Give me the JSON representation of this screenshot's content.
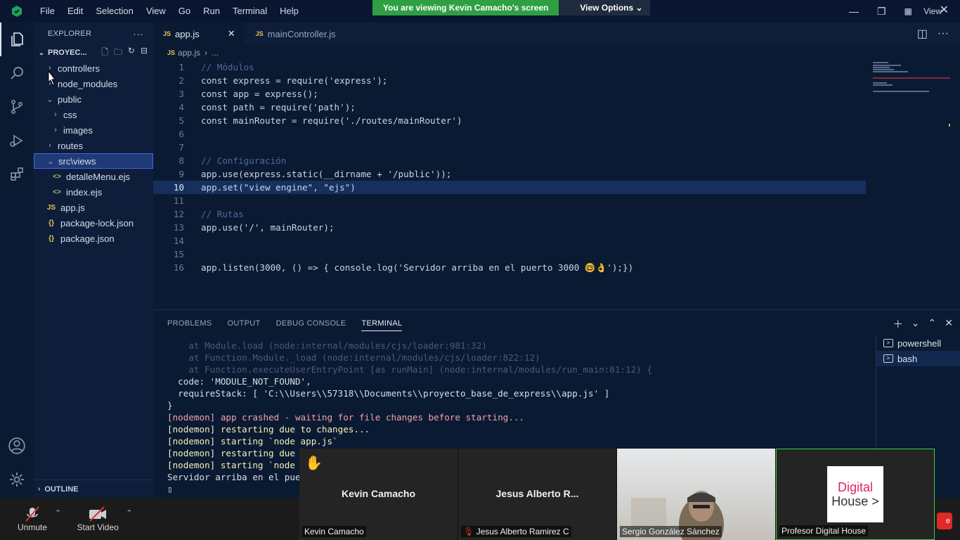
{
  "menu": [
    "File",
    "Edit",
    "Selection",
    "View",
    "Go",
    "Run",
    "Terminal",
    "Help"
  ],
  "share_banner": {
    "text": "You are viewing Kevin Camacho's screen",
    "options": "View Options"
  },
  "window_view_label": "View",
  "sidebar": {
    "title": "EXPLORER",
    "folder": "PROYEC...",
    "items": [
      {
        "label": "controllers",
        "type": "folder",
        "level": 1
      },
      {
        "label": "node_modules",
        "type": "folder",
        "level": 1
      },
      {
        "label": "public",
        "type": "folder-open",
        "level": 1
      },
      {
        "label": "css",
        "type": "folder",
        "level": 2
      },
      {
        "label": "images",
        "type": "folder",
        "level": 2
      },
      {
        "label": "routes",
        "type": "folder",
        "level": 1
      },
      {
        "label": "src\\views",
        "type": "folder-open",
        "level": 1
      },
      {
        "label": "detalleMenu.ejs",
        "type": "ejs",
        "level": 2
      },
      {
        "label": "index.ejs",
        "type": "ejs",
        "level": 2
      },
      {
        "label": "app.js",
        "type": "js",
        "level": 1
      },
      {
        "label": "package-lock.json",
        "type": "json",
        "level": 1
      },
      {
        "label": "package.json",
        "type": "json",
        "level": 1
      }
    ],
    "outline": "OUTLINE"
  },
  "tabs": [
    {
      "label": "app.js",
      "active": true
    },
    {
      "label": "mainController.js",
      "active": false
    }
  ],
  "breadcrumb": {
    "file": "app.js",
    "rest": "..."
  },
  "code_lines": [
    "// Módulos",
    "const express = require('express');",
    "const app = express();",
    "const path = require('path');",
    "const mainRouter = require('./routes/mainRouter')",
    "",
    "",
    "// Configuración",
    "app.use(express.static(__dirname + '/public'));",
    "app.set(\"view engine\", \"ejs\")",
    "",
    "// Rutas",
    "app.use('/', mainRouter);",
    "",
    "",
    "app.listen(3000, () => { console.log('Servidor arriba en el puerto 3000 🤓👌');})"
  ],
  "current_line": 10,
  "panel": {
    "tabs": [
      "PROBLEMS",
      "OUTPUT",
      "DEBUG CONSOLE",
      "TERMINAL"
    ],
    "active_tab": "TERMINAL",
    "terminal_lines": [
      {
        "text": "    at Module.load (node:internal/modules/cjs/loader:981:32)",
        "style": "dim"
      },
      {
        "text": "    at Function.Module._load (node:internal/modules/cjs/loader:822:12)",
        "style": "dim"
      },
      {
        "text": "    at Function.executeUserEntryPoint [as runMain] (node:internal/modules/run_main:81:12) {",
        "style": "dim"
      },
      {
        "text": "  code: 'MODULE_NOT_FOUND',",
        "style": "normal"
      },
      {
        "text": "  requireStack: [ 'C:\\\\Users\\\\57318\\\\Documents\\\\proyecto_base_de_express\\\\app.js' ]",
        "style": "normal"
      },
      {
        "text": "}",
        "style": "normal"
      },
      {
        "text": "[nodemon] app crashed - waiting for file changes before starting...",
        "style": "red"
      },
      {
        "text": "[nodemon] restarting due to changes...",
        "style": "ylw"
      },
      {
        "text": "[nodemon] starting `node app.js`",
        "style": "ylw"
      },
      {
        "text": "[nodemon] restarting due to",
        "style": "ylw"
      },
      {
        "text": "[nodemon] starting `node ap",
        "style": "ylw"
      },
      {
        "text": "Servidor arriba en el puert",
        "style": "normal"
      },
      {
        "text": "▯",
        "style": "normal"
      }
    ],
    "terminals": [
      {
        "label": "powershell",
        "selected": false
      },
      {
        "label": "bash",
        "selected": true
      }
    ]
  },
  "zoom": {
    "unmute": "Unmute",
    "start_video": "Start Video"
  },
  "participants": [
    {
      "big_name": "Kevin Camacho",
      "label": "Kevin Camacho",
      "hand": "✋"
    },
    {
      "big_name": "Jesus Alberto R...",
      "label": "Jesus Alberto Ramirez C"
    },
    {
      "big_name": "",
      "label": "Sergio González Sánchez"
    },
    {
      "big_name": "",
      "label": "Profesor Digital House",
      "logo": "Digital House >"
    }
  ],
  "colors": {
    "editor_bg": "#0b1a33",
    "accent": "#2ea043",
    "selection": "#1f3a77"
  }
}
